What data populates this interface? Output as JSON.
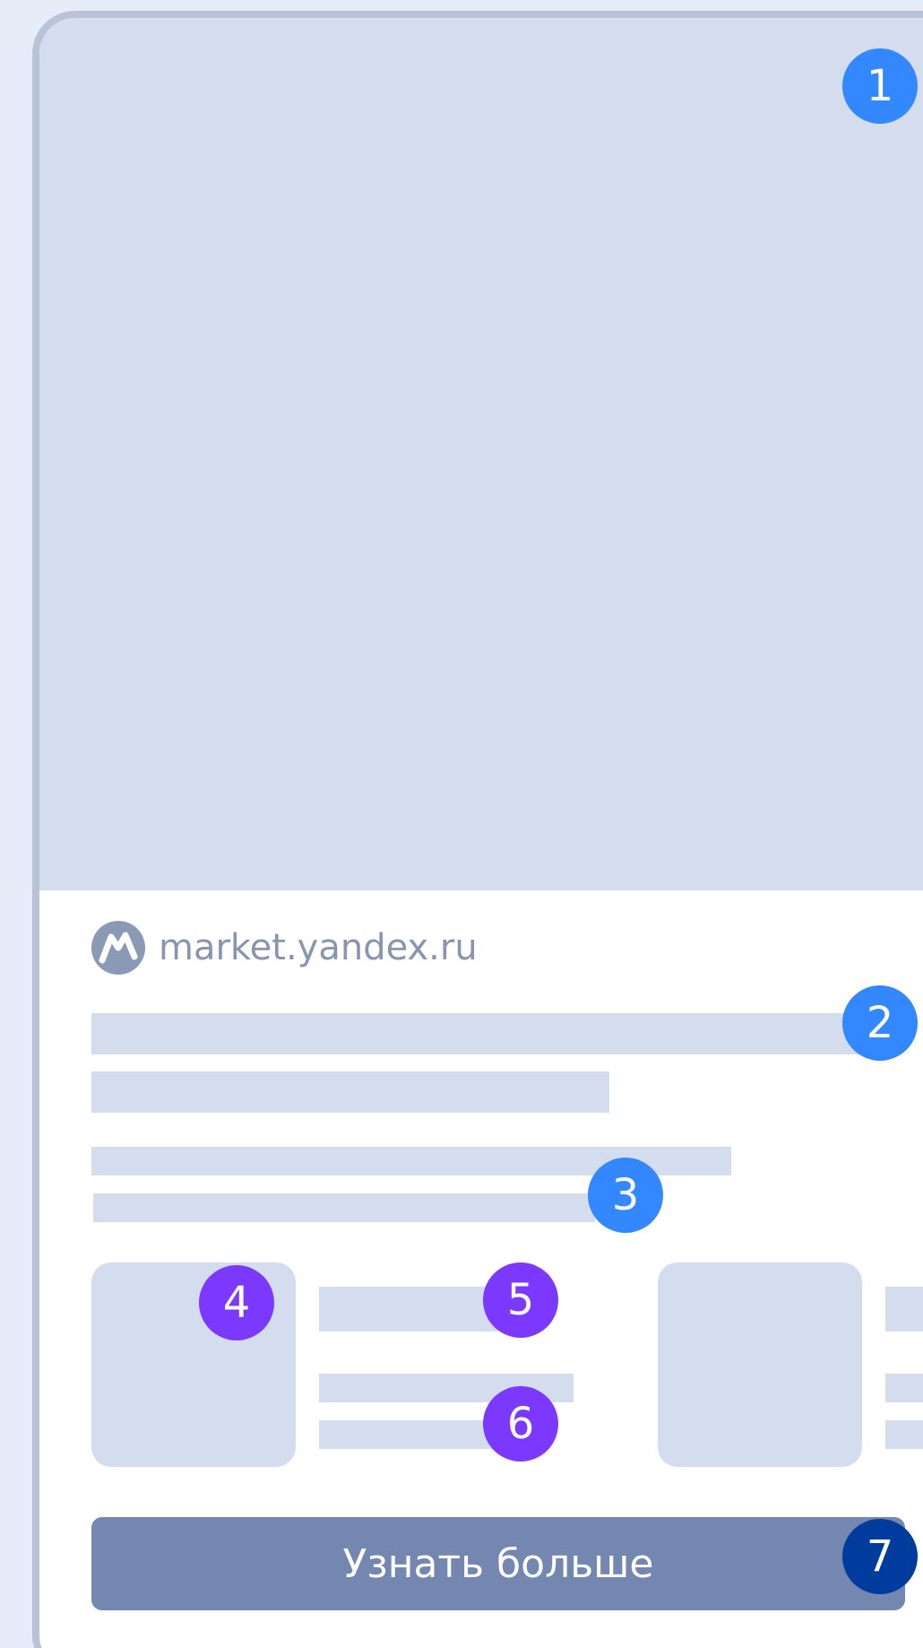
{
  "card": {
    "domain": "market.yandex.ru",
    "cta_label": "Узнать больше"
  },
  "badges": [
    {
      "label": "1",
      "color": "#3388ff"
    },
    {
      "label": "2",
      "color": "#3388ff"
    },
    {
      "label": "3",
      "color": "#3388ff"
    },
    {
      "label": "4",
      "color": "#7b38ff"
    },
    {
      "label": "5",
      "color": "#7b38ff"
    },
    {
      "label": "6",
      "color": "#7b38ff"
    },
    {
      "label": "7",
      "color": "#003c9e"
    }
  ],
  "colors": {
    "background": "#e6edf8",
    "placeholder": "#d3ddee",
    "button": "#7387b0",
    "domain_text": "#8795b0"
  }
}
